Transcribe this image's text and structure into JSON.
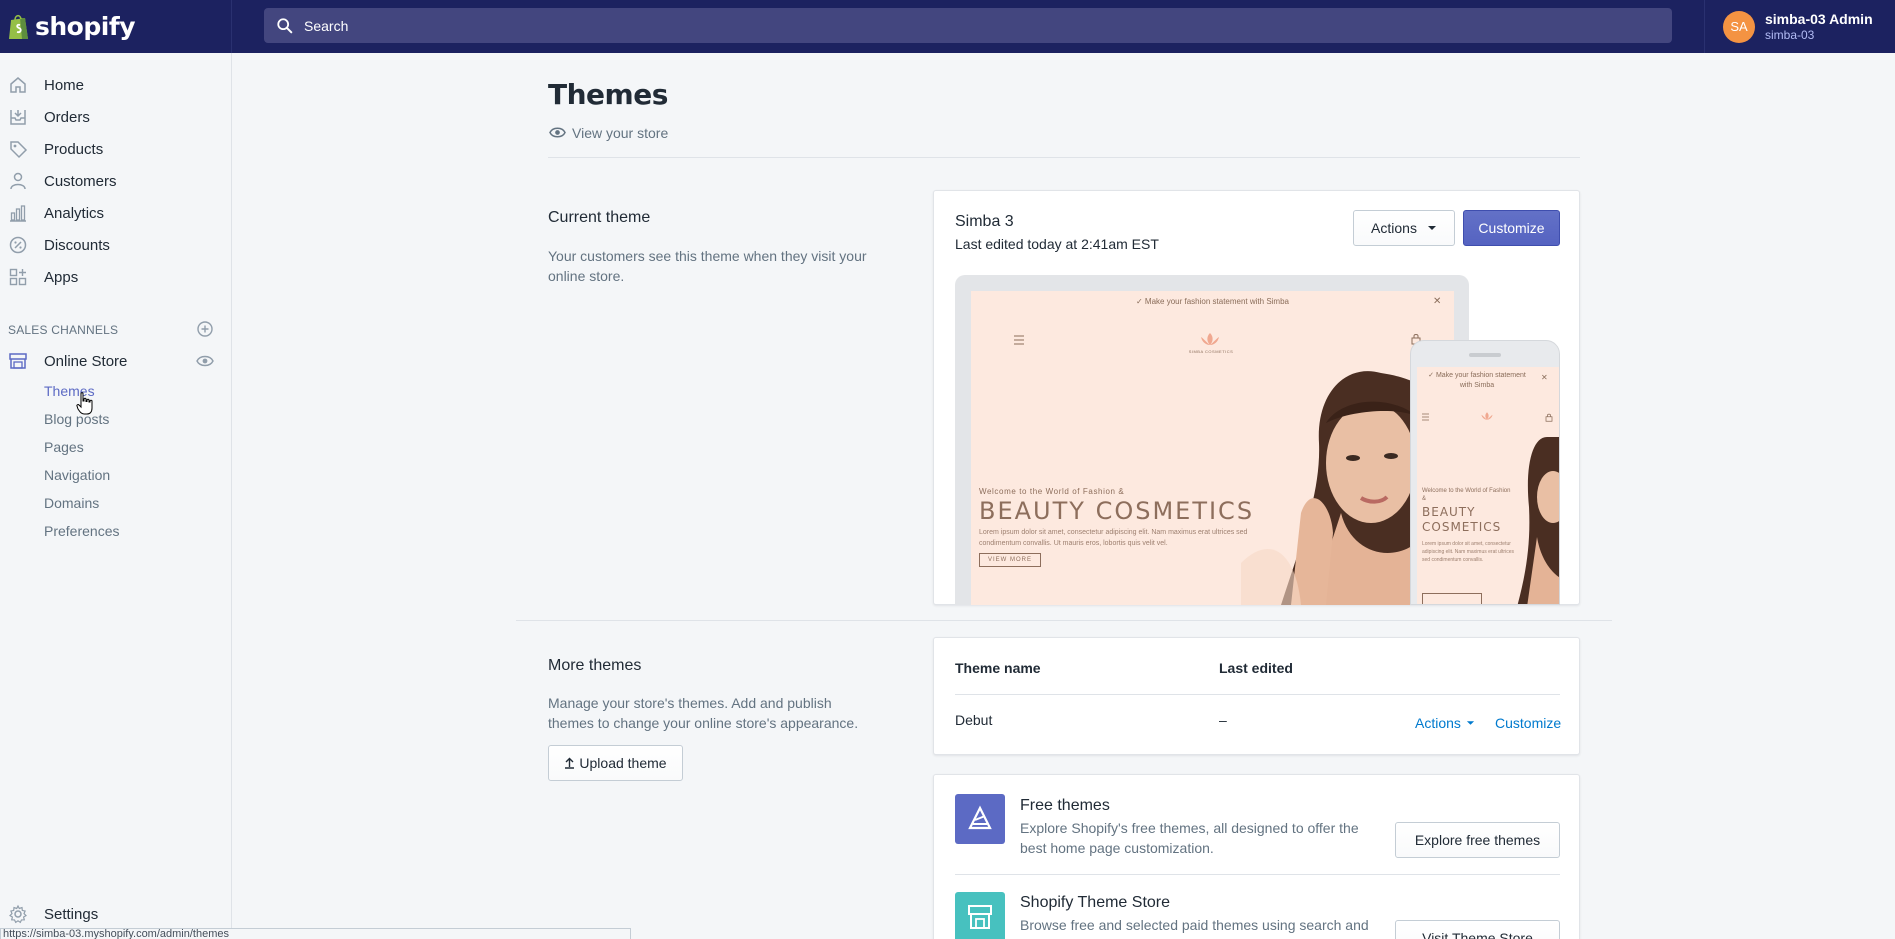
{
  "topbar": {
    "brand": "shopify",
    "search_placeholder": "Search",
    "user_initials": "SA",
    "user_name": "simba-03 Admin",
    "user_store": "simba-03"
  },
  "sidebar": {
    "items": [
      {
        "label": "Home",
        "icon": "home-icon"
      },
      {
        "label": "Orders",
        "icon": "orders-icon"
      },
      {
        "label": "Products",
        "icon": "tag-icon"
      },
      {
        "label": "Customers",
        "icon": "person-icon"
      },
      {
        "label": "Analytics",
        "icon": "bar-chart-icon"
      },
      {
        "label": "Discounts",
        "icon": "discount-icon"
      },
      {
        "label": "Apps",
        "icon": "apps-icon"
      }
    ],
    "sales_channels_header": "SALES CHANNELS",
    "online_store_label": "Online Store",
    "online_store_subitems": [
      "Themes",
      "Blog posts",
      "Pages",
      "Navigation",
      "Domains",
      "Preferences"
    ],
    "active_subitem": "Themes",
    "settings_label": "Settings"
  },
  "statusbar": {
    "url": "https://simba-03.myshopify.com/admin/themes"
  },
  "page": {
    "title": "Themes",
    "view_store": "View your store"
  },
  "current_theme": {
    "section_title": "Current theme",
    "section_desc": "Your customers see this theme when they visit your online store.",
    "name": "Simba 3",
    "last_edited": "Last edited today at 2:41am EST",
    "actions_label": "Actions",
    "customize_label": "Customize",
    "preview": {
      "announcement": "✓ Make your fashion statement with Simba",
      "brand": "SIMBA COSMETICS",
      "hero_sub": "Welcome to the World of Fashion &",
      "hero_title": "BEAUTY COSMETICS",
      "hero_text": "Lorem ipsum dolor sit amet, consectetur adipiscing elit. Nam maximus erat ultrices sed condimentum convallis. Ut mauris eros, lobortis quis velit vel.",
      "hero_button": "VIEW MORE",
      "mobile_announcement": "✓ Make your fashion statement with Simba",
      "mobile_hero_sub": "Welcome to the World of Fashion &",
      "mobile_hero_title": "BEAUTY COSMETICS",
      "mobile_hero_text": "Lorem ipsum dolor sit amet, consectetur adipiscing elit. Nam maximus erat ultrices sed condimentum convallis."
    }
  },
  "more_themes": {
    "section_title": "More themes",
    "section_desc": "Manage your store's themes. Add and publish themes to change your online store's appearance.",
    "upload_label": "Upload theme",
    "table_headers": [
      "Theme name",
      "Last edited"
    ],
    "rows": [
      {
        "name": "Debut",
        "last_edited": "–",
        "actions": "Actions",
        "customize": "Customize"
      }
    ]
  },
  "tiles": [
    {
      "title": "Free themes",
      "desc": "Explore Shopify's free themes, all designed to offer the best home page customization.",
      "button": "Explore free themes",
      "icon": "free-themes-icon",
      "color": "#5c6ac4"
    },
    {
      "title": "Shopify Theme Store",
      "desc": "Browse free and selected paid themes using search and",
      "button": "Visit Theme Store",
      "icon": "theme-store-icon",
      "color": "#47c1bf"
    }
  ],
  "colors": {
    "topbar": "#1c2260",
    "accent": "#5c6ac4",
    "link": "#007ace",
    "avatar": "#f49342"
  }
}
